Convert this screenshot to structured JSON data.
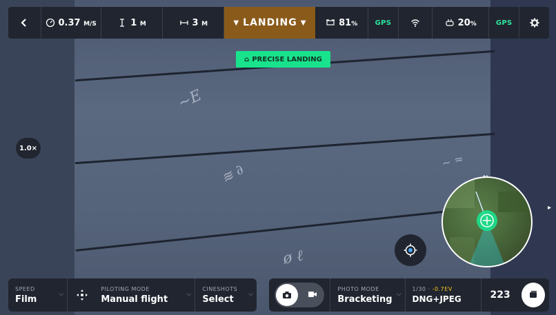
{
  "topbar": {
    "speed_value": "0.37",
    "speed_unit": "M/S",
    "altitude_value": "1",
    "altitude_unit": "M",
    "distance_value": "3",
    "distance_unit": "M",
    "flight_state": "LANDING",
    "drone_battery": "81",
    "drone_battery_unit": "%",
    "drone_gps": "GPS",
    "controller_battery": "20",
    "controller_battery_unit": "%",
    "controller_gps": "GPS"
  },
  "precise_landing": "PRECISE LANDING",
  "zoom_level": "1.0×",
  "minimap": {
    "north": "N"
  },
  "bottombar": {
    "speed_label": "SPEED",
    "speed_value": "Film",
    "piloting_label": "PILOTING MODE",
    "piloting_value": "Manual flight",
    "cineshots_label": "CINESHOTS",
    "cineshots_value": "Select",
    "photo_mode_label": "PHOTO MODE",
    "photo_mode_value": "Bracketing",
    "shutter": "1/30",
    "ev": "-0.7EV",
    "format": "DNG+JPEG",
    "photo_count": "223"
  },
  "colors": {
    "landing_accent": "#8a5a1a",
    "precise_green": "#19e28d",
    "gps_green": "#2ee59d",
    "ev_yellow": "#f2c81b",
    "panel_bg": "#20252f"
  },
  "icons": [
    "back-icon",
    "speed-gauge-icon",
    "altitude-icon",
    "distance-icon",
    "drone-icon",
    "wifi-icon",
    "controller-icon",
    "settings-gear-icon",
    "home-icon",
    "recenter-icon",
    "move-icon",
    "camera-icon",
    "video-icon",
    "gallery-icon"
  ]
}
